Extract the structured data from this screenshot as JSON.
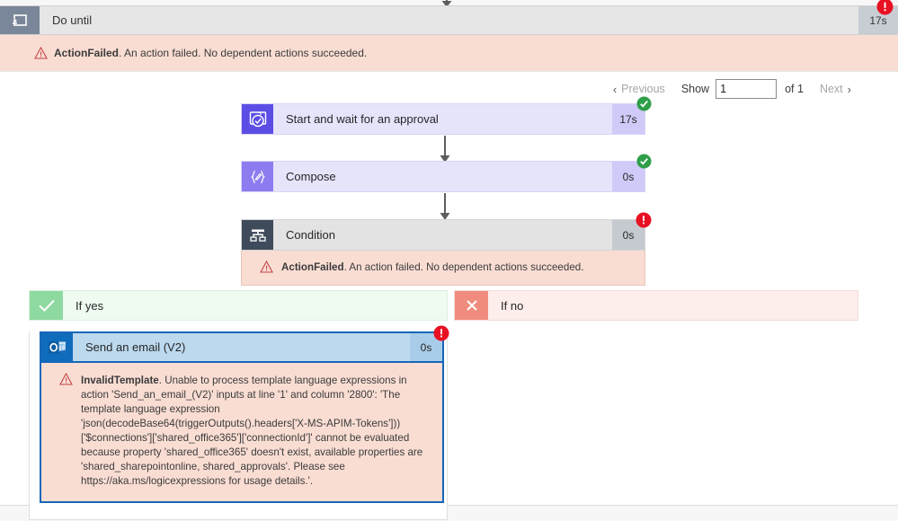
{
  "scope": {
    "title": "Do until",
    "duration": "17s",
    "icon": "do-until-loop-icon",
    "status": "failed",
    "error": {
      "code": "ActionFailed",
      "message": "An action failed. No dependent actions succeeded."
    }
  },
  "pager": {
    "previous_label": "Previous",
    "show_label": "Show",
    "page_value": "1",
    "page_placeholder": "1",
    "of_label": "of 1",
    "next_label": "Next"
  },
  "actions": [
    {
      "name": "Start and wait for an approval",
      "duration": "17s",
      "status": "succeeded",
      "icon": "approval-icon"
    },
    {
      "name": "Compose",
      "duration": "0s",
      "status": "succeeded",
      "icon": "compose-braces-icon"
    },
    {
      "name": "Condition",
      "duration": "0s",
      "status": "failed",
      "icon": "condition-branch-icon",
      "error": {
        "code": "ActionFailed",
        "message": "An action failed. No dependent actions succeeded."
      }
    }
  ],
  "branches": {
    "yes": {
      "label": "If yes",
      "icon": "checkmark-icon",
      "action": {
        "name": "Send an email (V2)",
        "duration": "0s",
        "status": "failed",
        "icon": "outlook-icon",
        "error": {
          "code": "InvalidTemplate",
          "message": "Unable to process template language expressions in action 'Send_an_email_(V2)' inputs at line '1' and column '2800': 'The template language expression 'json(decodeBase64(triggerOutputs().headers['X-MS-APIM-Tokens']))['$connections']['shared_office365']['connectionId']' cannot be evaluated because property 'shared_office365' doesn't exist, available properties are 'shared_sharepointonline, shared_approvals'. Please see https://aka.ms/logicexpressions for usage details.'."
        }
      }
    },
    "no": {
      "label": "If no",
      "icon": "close-x-icon"
    }
  },
  "colors": {
    "error_badge": "#e81123",
    "success_badge": "#2e9e48",
    "error_panel": "#f9ddd3",
    "purple_accent": "#5c4ee5",
    "outlook_blue": "#0f6cbd",
    "yes_green": "#8ed9a0",
    "no_red": "#f08c7d"
  }
}
